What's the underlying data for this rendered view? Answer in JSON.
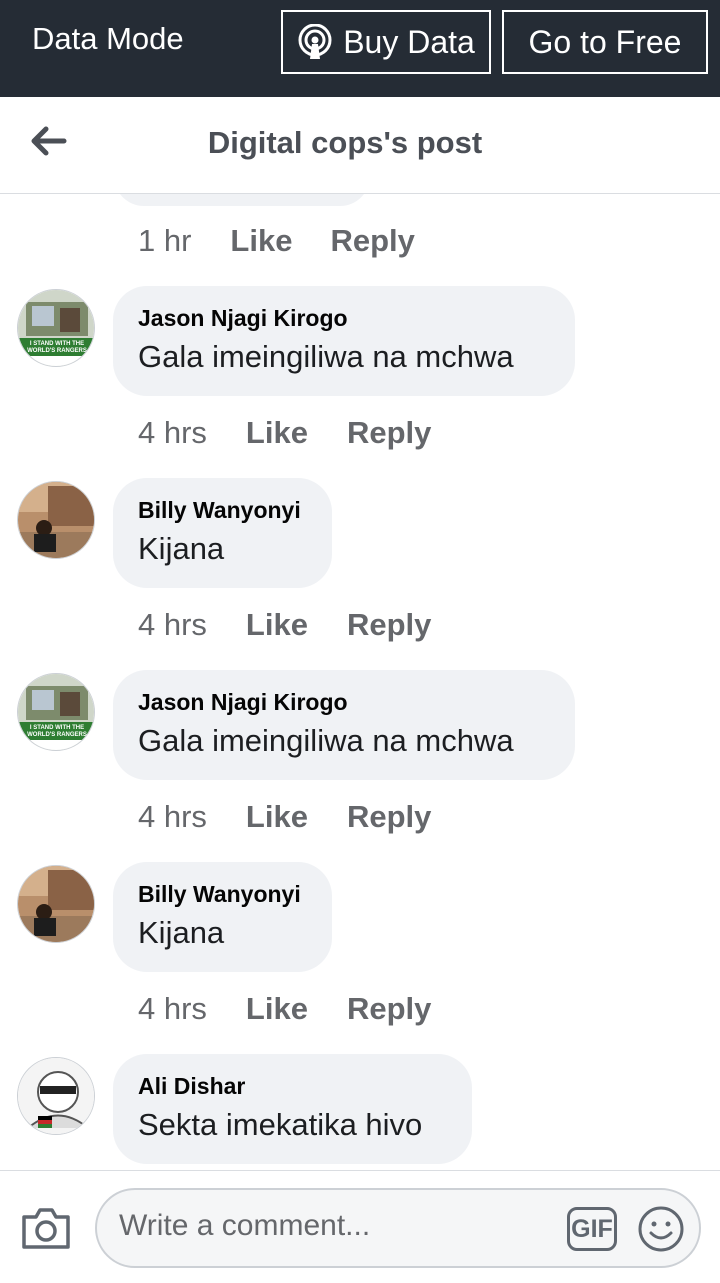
{
  "databar": {
    "mode_label": "Data Mode",
    "buy_label": "Buy Data",
    "free_label": "Go to Free"
  },
  "header": {
    "title": "Digital cops's post"
  },
  "top_meta": {
    "time": "1 hr",
    "like": "Like",
    "reply": "Reply"
  },
  "comments": [
    {
      "author": "Jason Njagi Kirogo",
      "text": "Gala imeingiliwa na mchwa",
      "time": "4 hrs",
      "like": "Like",
      "reply": "Reply",
      "avatar_badge": "I STAND WITH THE WORLD'S RANGERS"
    },
    {
      "author": "Billy Wanyonyi",
      "text": "Kijana",
      "time": "4 hrs",
      "like": "Like",
      "reply": "Reply"
    },
    {
      "author": "Jason Njagi Kirogo",
      "text": "Gala imeingiliwa na mchwa",
      "time": "4 hrs",
      "like": "Like",
      "reply": "Reply",
      "avatar_badge": "I STAND WITH THE WORLD'S RANGERS"
    },
    {
      "author": "Billy Wanyonyi",
      "text": "Kijana",
      "time": "4 hrs",
      "like": "Like",
      "reply": "Reply"
    },
    {
      "author": "Ali Dishar",
      "text": "Sekta imekatika hivo"
    }
  ],
  "composer": {
    "placeholder": "Write a comment...",
    "gif_label": "GIF"
  },
  "colors": {
    "databar_bg": "#252c35",
    "bubble_bg": "#f0f2f5",
    "meta_text": "#65676b"
  },
  "icons": [
    "back-arrow-icon",
    "broadcast-icon",
    "camera-icon",
    "gif-icon",
    "emoji-icon"
  ]
}
